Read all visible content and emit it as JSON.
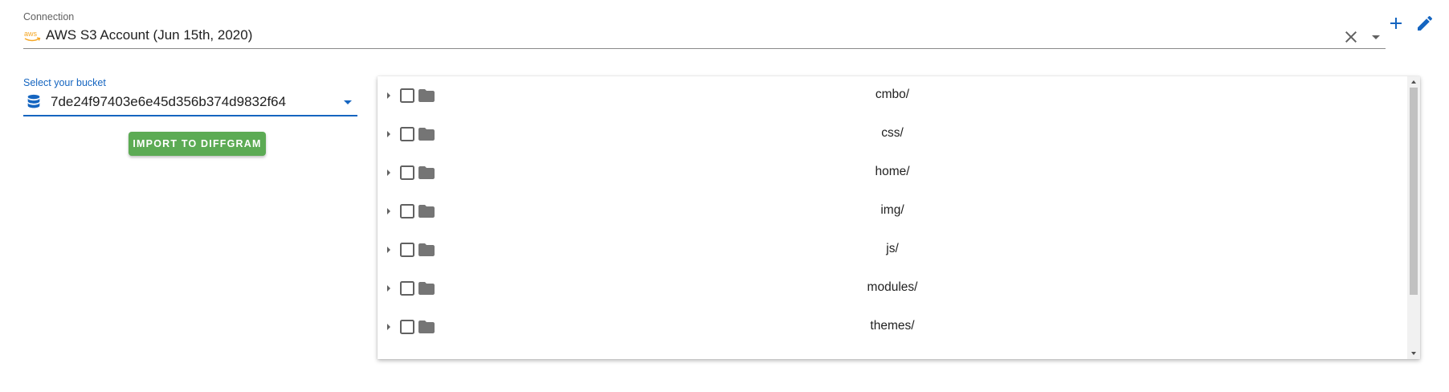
{
  "connection": {
    "label": "Connection",
    "value": "AWS S3 Account (Jun 15th, 2020)",
    "logo_text": "aws",
    "logo_color": "#f5a623"
  },
  "toolbar": {
    "add_icon": "plus-icon",
    "edit_icon": "pencil-icon",
    "icon_color": "#1565c0"
  },
  "bucket": {
    "label": "Select your bucket",
    "value": "7de24f97403e6e45d356b374d9832f64",
    "icon": "database-icon",
    "accent": "#1565c0"
  },
  "import_button": {
    "label": "IMPORT TO DIFFGRAM",
    "color": "#5cab54"
  },
  "tree": {
    "items": [
      {
        "name": "cmbo/"
      },
      {
        "name": "css/"
      },
      {
        "name": "home/"
      },
      {
        "name": "img/"
      },
      {
        "name": "js/"
      },
      {
        "name": "modules/"
      },
      {
        "name": "themes/"
      }
    ]
  }
}
